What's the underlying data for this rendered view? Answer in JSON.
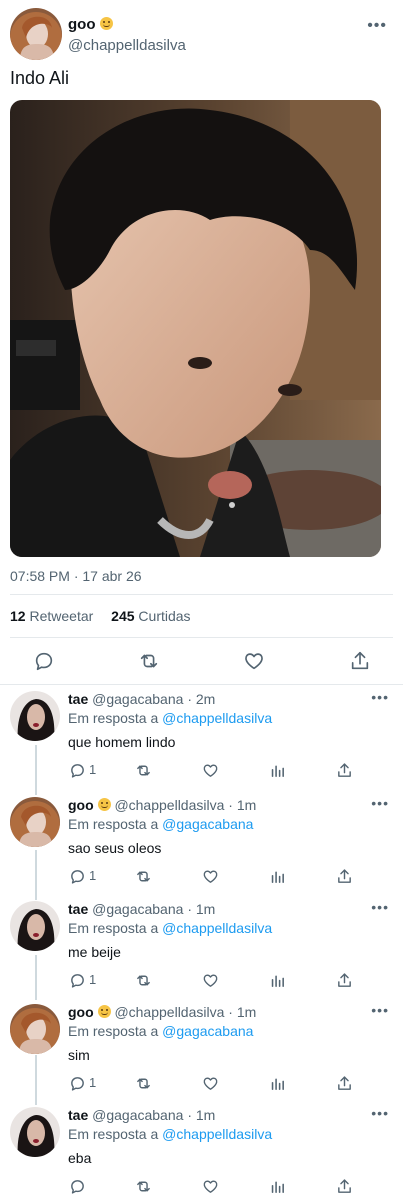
{
  "main_tweet": {
    "user_name": "goo",
    "handle": "@chappelldasilva",
    "text": "Indo Ali",
    "timestamp": "07:58 PM · 17 abr 26",
    "retweets_count": "12",
    "retweets_label": "Retweetar",
    "likes_count": "245",
    "likes_label": "Curtidas",
    "more": "•••"
  },
  "replies": [
    {
      "user_name": "tae",
      "emoji": false,
      "handle": "@gagacabana",
      "time": "· 2m",
      "in_reply_prefix": "Em resposta a",
      "in_reply_to": "@chappelldasilva",
      "text": "que homem lindo",
      "reply_count": "1",
      "more": "•••"
    },
    {
      "user_name": "goo",
      "emoji": true,
      "handle": "@chappelldasilva",
      "time": "· 1m",
      "in_reply_prefix": "Em resposta a",
      "in_reply_to": "@gagacabana",
      "text": "sao seus oleos",
      "reply_count": "1",
      "more": "•••"
    },
    {
      "user_name": "tae",
      "emoji": false,
      "handle": "@gagacabana",
      "time": "· 1m",
      "in_reply_prefix": "Em resposta a",
      "in_reply_to": "@chappelldasilva",
      "text": "me beije",
      "reply_count": "1",
      "more": "•••"
    },
    {
      "user_name": "goo",
      "emoji": true,
      "handle": "@chappelldasilva",
      "time": "· 1m",
      "in_reply_prefix": "Em resposta a",
      "in_reply_to": "@gagacabana",
      "text": "sim",
      "reply_count": "1",
      "more": "•••"
    },
    {
      "user_name": "tae",
      "emoji": false,
      "handle": "@gagacabana",
      "time": "· 1m",
      "in_reply_prefix": "Em resposta a",
      "in_reply_to": "@chappelldasilva",
      "text": "eba",
      "reply_count": "",
      "more": "•••"
    }
  ],
  "icons": {
    "reply": "reply-icon",
    "retweet": "retweet-icon",
    "like": "heart-icon",
    "views": "analytics-icon",
    "share": "share-icon",
    "more": "more-icon"
  },
  "colors": {
    "link": "#1d9bf0",
    "muted": "#536471",
    "text": "#0f1419",
    "thread_line": "#cfd9de"
  }
}
